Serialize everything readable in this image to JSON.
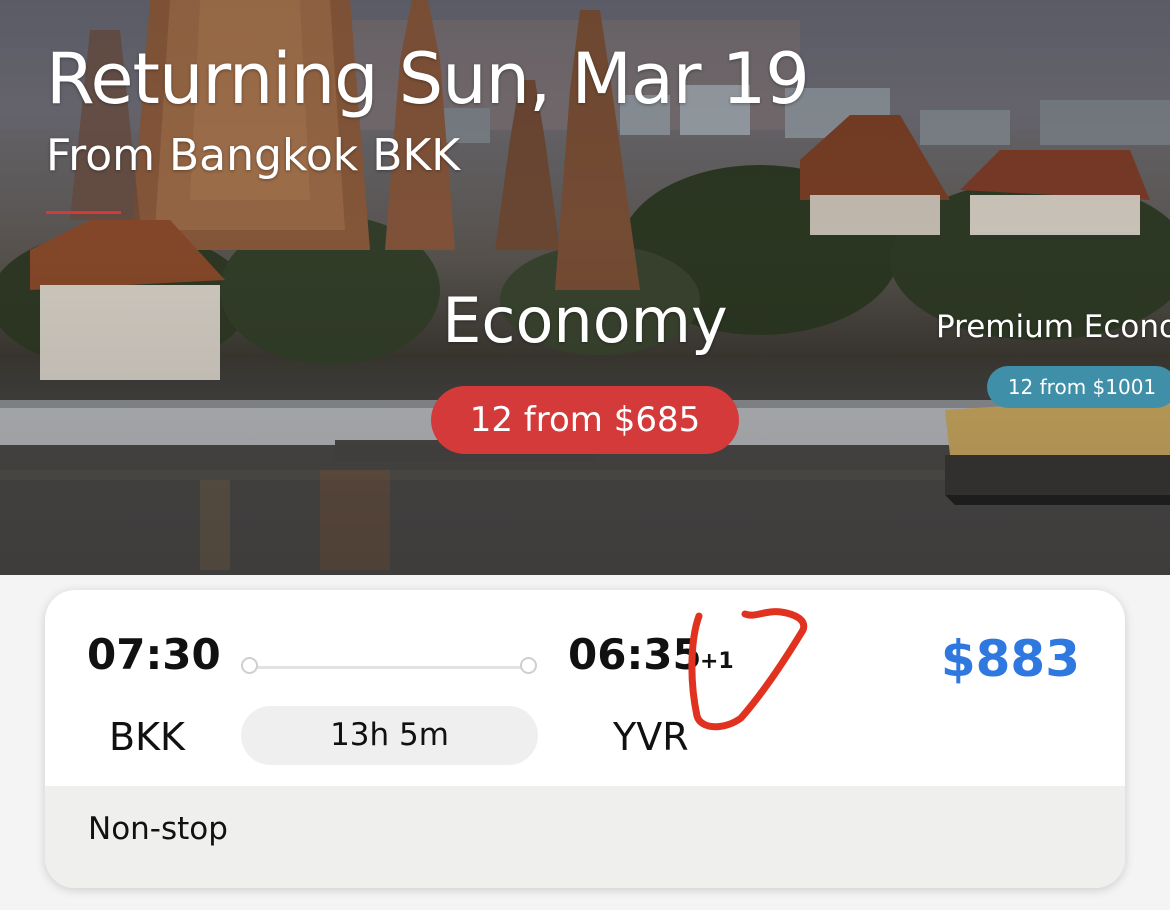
{
  "header": {
    "title": "Returning Sun, Mar 19",
    "subtitle": "From Bangkok BKK"
  },
  "cabins": [
    {
      "name": "Economy",
      "availability": "12 from $685",
      "selected": true
    },
    {
      "name": "Premium Econo",
      "availability": "12 from $1001",
      "selected": false
    }
  ],
  "flight": {
    "departure": {
      "time": "07:30",
      "airport": "BKK"
    },
    "arrival": {
      "time": "06:35",
      "day_offset": "+1",
      "airport": "YVR"
    },
    "duration": "13h 5m",
    "price": "$883",
    "stops": "Non-stop"
  },
  "colors": {
    "accent_red": "#d53a3a",
    "price_blue": "#2f78e0",
    "alt_cabin_teal": "#3f8fa9"
  },
  "icons": {
    "route_start": "circle-outline",
    "route_end": "circle-outline"
  }
}
